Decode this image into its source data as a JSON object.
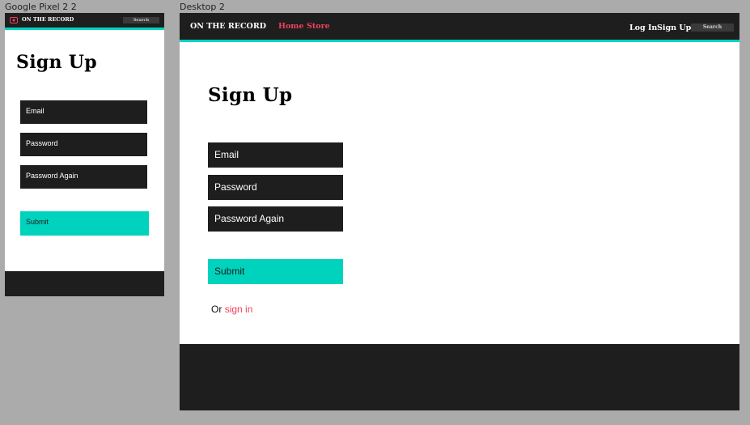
{
  "mobile": {
    "frame_label": "Google Pixel 2 2",
    "brand": "ON THE RECORD",
    "search_label": "Search",
    "heading": "Sign Up",
    "fields": {
      "email": "Email",
      "password": "Password",
      "password_again": "Password Again"
    },
    "submit_label": "Submit"
  },
  "desktop": {
    "frame_label": "Desktop 2",
    "brand": "ON THE RECORD",
    "nav": {
      "home": "Home",
      "store": "Store"
    },
    "auth": {
      "login": "Log In",
      "signup": "Sign Up"
    },
    "search_label": "Search",
    "heading": "Sign Up",
    "fields": {
      "email": "Email",
      "password": "Password",
      "password_again": "Password Again"
    },
    "submit_label": "Submit",
    "alt_prefix": "Or",
    "alt_link": "sign in"
  },
  "icons": {
    "logo": "record-logo-icon"
  },
  "colors": {
    "canvas": "#ababab",
    "dark": "#1e1e1e",
    "accent": "#00d3bd",
    "link": "#f2405c",
    "search": "#3a3a3a"
  }
}
